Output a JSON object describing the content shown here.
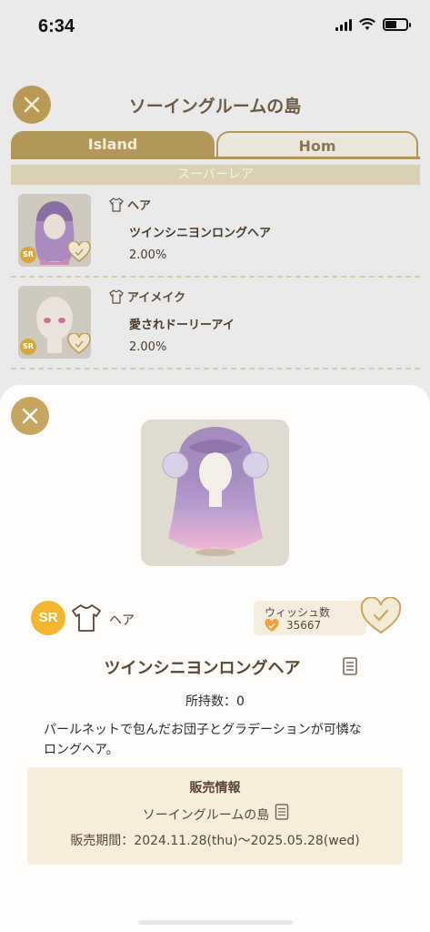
{
  "status_bar": {
    "time": "6:34"
  },
  "background": {
    "title": "ソーイングルームの島",
    "tabs": [
      "Island",
      "Hom"
    ],
    "rarity_header": "スーパーレア",
    "items": [
      {
        "rarity": "SR",
        "category": "ヘア",
        "name": "ツインシニヨンロングヘア",
        "rate": "2.00%"
      },
      {
        "rarity": "SR",
        "category": "アイメイク",
        "name": "愛されドーリーアイ",
        "rate": "2.00%"
      }
    ]
  },
  "detail": {
    "rarity": "SR",
    "category": "ヘア",
    "wish_label": "ウィッシュ数",
    "wish_count": "35667",
    "name": "ツインシニヨンロングヘア",
    "owned": "所持数：0",
    "description": "パールネットで包んだお団子とグラデーションが可憐なロングヘア。",
    "sale": {
      "title": "販売情報",
      "shop": "ソーイングルームの島",
      "period": "販売期間：2024.11.28(thu)～2025.05.28(wed)"
    }
  },
  "colors": {
    "gold": "#c7a65f",
    "sr_badge": "#f2b72e",
    "sale_bg": "#f6eddd",
    "wish_heart_orange": "#f0a13a"
  },
  "icons": {
    "close": "close-icon",
    "category": "shirt-icon",
    "wish": "heart-check-icon",
    "doc": "document-icon"
  }
}
